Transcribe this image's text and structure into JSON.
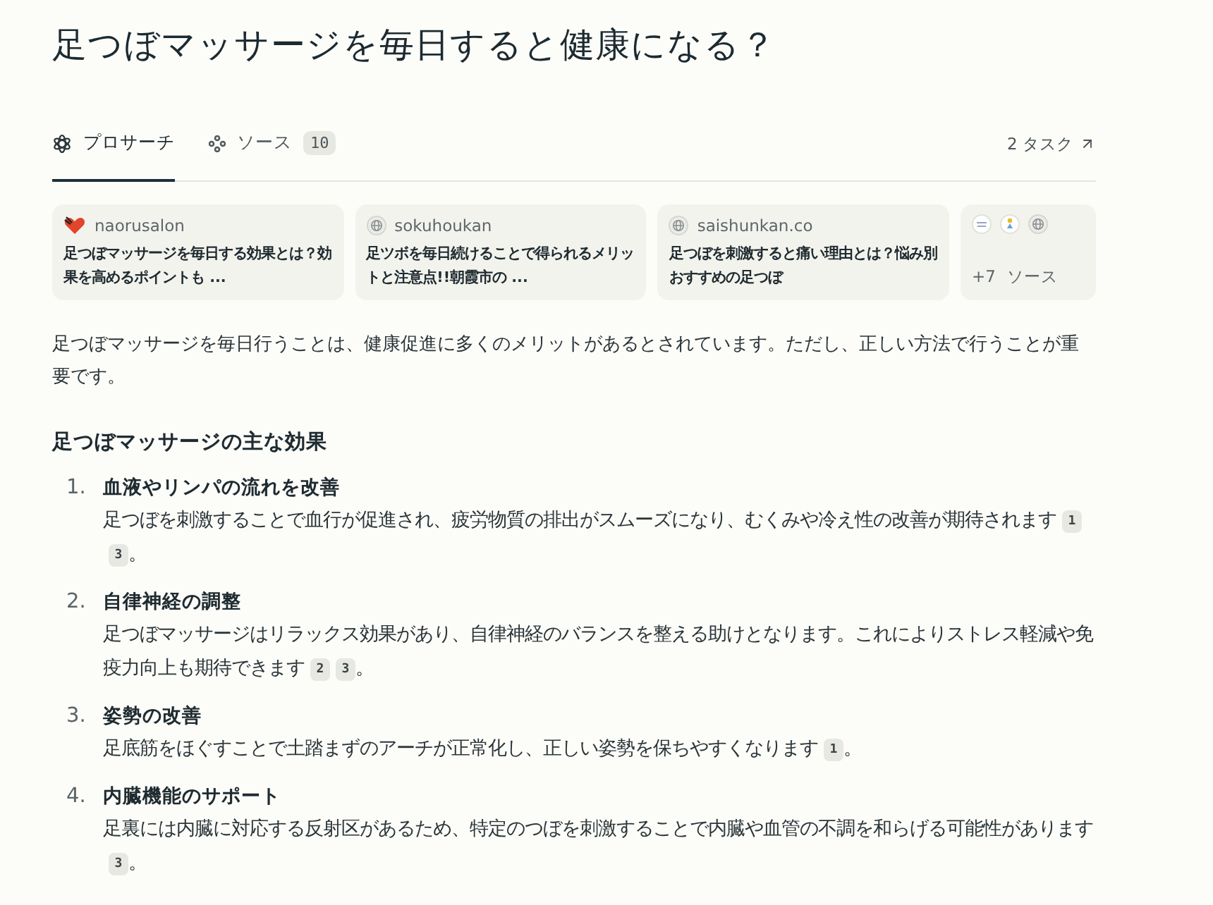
{
  "title": "足つぼマッサージを毎日すると健康になる？",
  "tabs": [
    {
      "label": "プロサーチ",
      "selected": true
    },
    {
      "label": "ソース",
      "badge": "10",
      "selected": false
    }
  ],
  "tasks_link": {
    "label": "2 タスク"
  },
  "source_cards": [
    {
      "kind": "source",
      "domain": "naorusalon",
      "title": "足つぼマッサージを毎日する効果とは？効果を高めるポイントも ..."
    },
    {
      "kind": "source",
      "domain": "sokuhoukan",
      "title": "足ツボを毎日続けることで得られるメリットと注意点!!朝霞市の ..."
    },
    {
      "kind": "source",
      "domain": "saishunkan.co",
      "title": "足つぼを刺激すると痛い理由とは？悩み別おすすめの足つぼ"
    },
    {
      "kind": "more",
      "count": "+7",
      "label": "ソース"
    }
  ],
  "intro": "足つぼマッサージを毎日行うことは、健康促進に多くのメリットがあるとされています。ただし、正しい方法で行うことが重要です。",
  "section_heading": "足つぼマッサージの主な効果",
  "effects": [
    {
      "number": "1.",
      "title": "血液やリンパの流れを改善",
      "text": "足つぼを刺激することで血行が促進され、疲労物質の排出がスムーズになり、むくみや冷え性の改善が期待されます",
      "citations": [
        "1",
        "3"
      ],
      "end": "。"
    },
    {
      "number": "2.",
      "title": "自律神経の調整",
      "text": "足つぼマッサージはリラックス効果があり、自律神経のバランスを整える助けとなります。これによりストレス軽減や免疫力向上も期待できます",
      "citations": [
        "2",
        "3"
      ],
      "end": "。"
    },
    {
      "number": "3.",
      "title": "姿勢の改善",
      "text": "足底筋をほぐすことで土踏まずのアーチが正常化し、正しい姿勢を保ちやすくなります",
      "citations": [
        "1"
      ],
      "end": "。"
    },
    {
      "number": "4.",
      "title": "内臓機能のサポート",
      "text": "足裏には内臓に対応する反射区があるため、特定のつぼを刺激することで内臓や血管の不調を和らげる可能性があります",
      "citations": [
        "3"
      ],
      "end": "。"
    }
  ]
}
